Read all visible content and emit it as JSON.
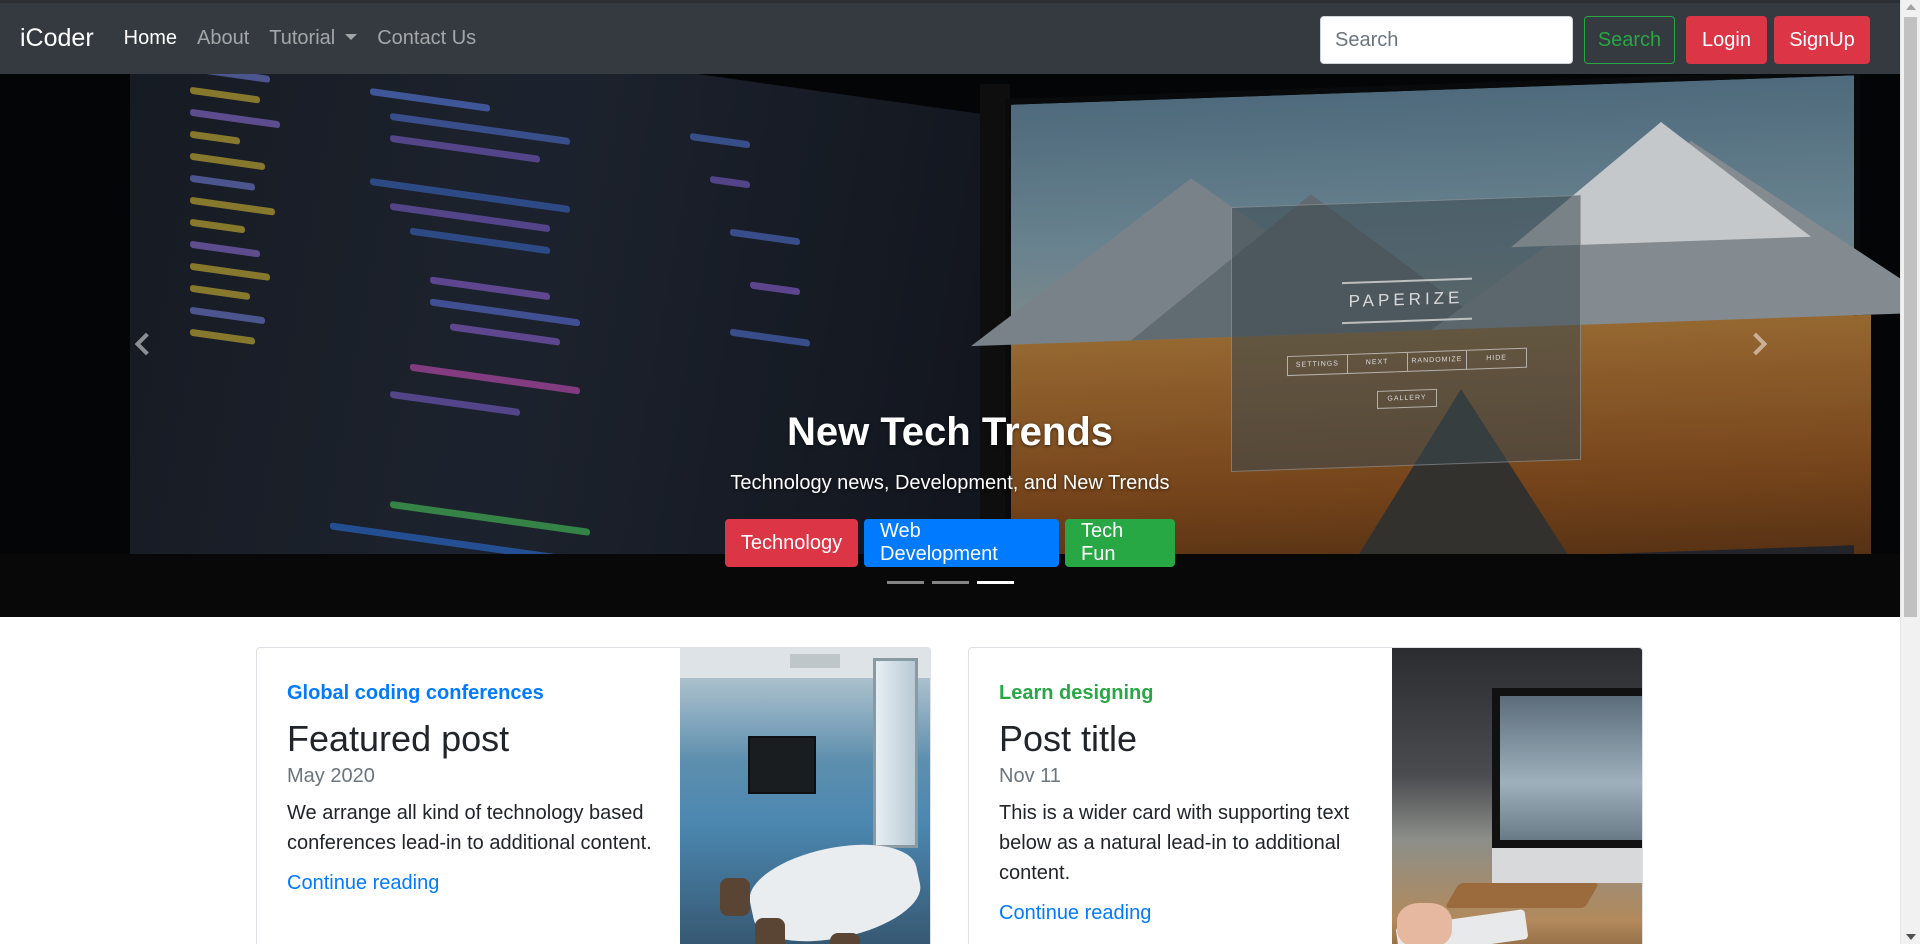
{
  "navbar": {
    "brand": "iCoder",
    "links": [
      {
        "label": "Home",
        "active": true
      },
      {
        "label": "About",
        "active": false
      },
      {
        "label": "Tutorial",
        "active": false,
        "dropdown": true
      },
      {
        "label": "Contact Us",
        "active": false
      }
    ],
    "search_placeholder": "Search",
    "search_button": "Search",
    "login_button": "Login",
    "signup_button": "SignUp"
  },
  "carousel": {
    "title": "New Tech Trends",
    "subtitle": "Technology news, Development, and New Trends",
    "buttons": [
      "Technology",
      "Web Development",
      "Tech Fun"
    ],
    "slide_count": 3,
    "active_slide": 3,
    "screen_app_title": "PAPERIZE",
    "screen_app_buttons": [
      "SETTINGS",
      "NEXT",
      "RANDOMIZE",
      "HIDE"
    ],
    "screen_app_gallery": "GALLERY"
  },
  "cards": [
    {
      "category": "Global coding conferences",
      "title": "Featured post",
      "date": "May 2020",
      "text": "We arrange all kind of technology based conferences lead-in to additional content.",
      "link": "Continue reading"
    },
    {
      "category": "Learn designing",
      "title": "Post title",
      "date": "Nov 11",
      "text": "This is a wider card with supporting text below as a natural lead-in to additional content.",
      "link": "Continue reading"
    }
  ],
  "colors": {
    "navbar_bg": "#343a40",
    "primary": "#007bff",
    "success": "#28a745",
    "danger": "#dc3545"
  }
}
